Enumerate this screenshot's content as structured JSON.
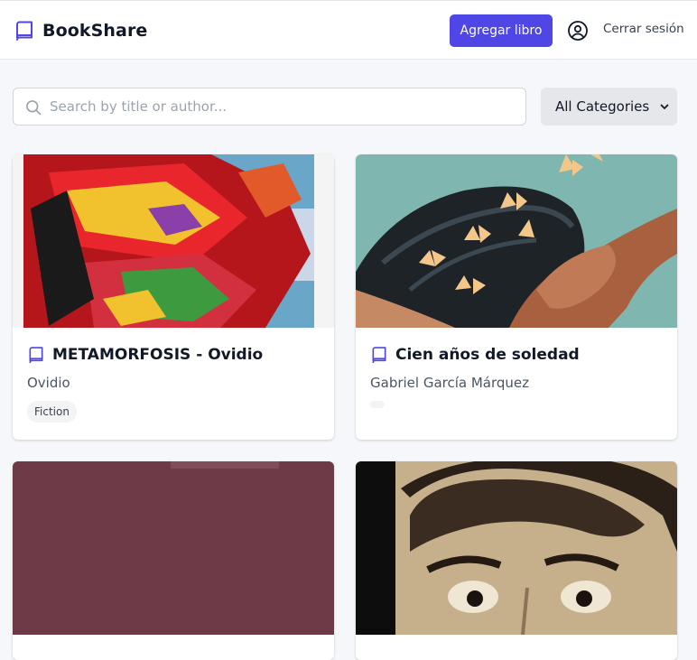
{
  "header": {
    "brand": "BookShare",
    "brand_icon": "book-icon",
    "add_book_label": "Agregar libro",
    "user_icon": "user-circle-icon",
    "logout_label": "Cerrar sesión",
    "accent": "#4f46e5"
  },
  "filters": {
    "search_placeholder": "Search by title or author...",
    "search_value": "",
    "category_selected": "All Categories"
  },
  "books": [
    {
      "title": "METAMORFOSIS - Ovidio",
      "author": "Ovidio",
      "category": "Fiction",
      "cover": "butterfly-wing-painting"
    },
    {
      "title": "Cien años de soledad",
      "author": "Gabriel García Márquez",
      "category": "",
      "cover": "woman-with-butterflies"
    },
    {
      "title": "",
      "author": "",
      "category": "",
      "cover": "maroon-cover"
    },
    {
      "title": "",
      "author": "",
      "category": "",
      "cover": "sepia-face-photo"
    }
  ]
}
